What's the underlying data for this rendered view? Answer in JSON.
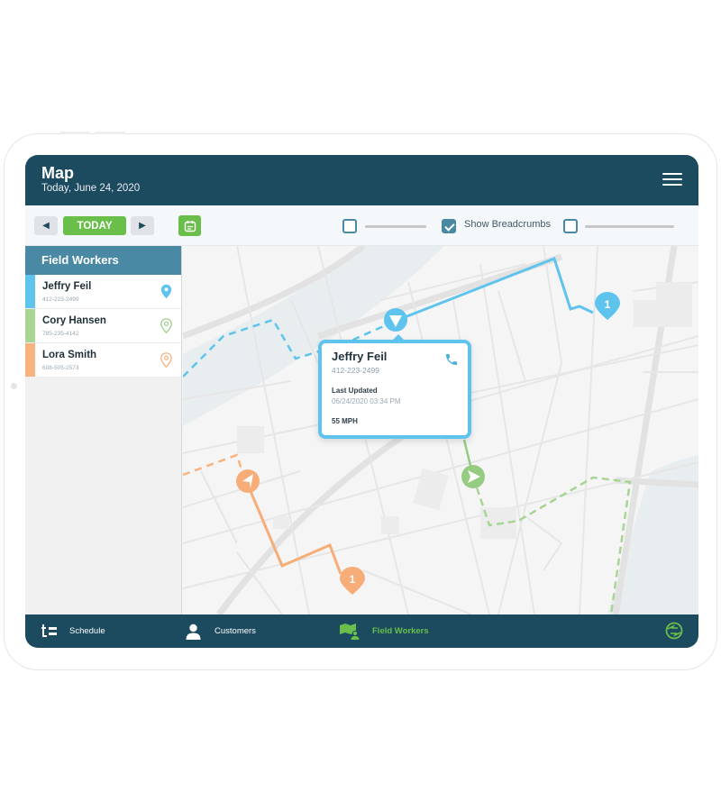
{
  "header": {
    "title": "Map",
    "subtitle": "Today, June 24, 2020",
    "menu_icon": "hamburger-menu-icon"
  },
  "toolbar": {
    "prev_icon": "arrow-left-icon",
    "today_label": "TODAY",
    "next_icon": "arrow-right-icon",
    "calendar_icon": "calendar-icon",
    "prev_glyph": "◀",
    "next_glyph": "▶",
    "checkboxes": [
      {
        "label": "",
        "checked": false
      },
      {
        "label": "Show Breadcrumbs",
        "checked": true
      },
      {
        "label": "",
        "checked": false
      }
    ]
  },
  "sidebar": {
    "title": "Field Workers",
    "workers": [
      {
        "name": "Jeffry Feil",
        "phone": "412-223-2499",
        "color": "#5ec4ee",
        "pin": "filled"
      },
      {
        "name": "Cory Hansen",
        "phone": "785-235-4142",
        "color": "#a9d494",
        "pin": "outline"
      },
      {
        "name": "Lora Smith",
        "phone": "608-505-2573",
        "color": "#f9b37f",
        "pin": "outline"
      }
    ]
  },
  "popup": {
    "name": "Jeffry Feil",
    "phone": "412-223-2499",
    "last_updated_label": "Last Updated",
    "last_updated": "06/24/2020  03:34 PM",
    "speed": "55 MPH",
    "call_icon": "phone-icon"
  },
  "map": {
    "markers": [
      {
        "worker": "Jeffry Feil",
        "type": "vehicle",
        "color": "#5ec4ee"
      },
      {
        "worker": "Jeffry Feil",
        "type": "stop",
        "label": "1",
        "color": "#5ec4ee"
      },
      {
        "worker": "Cory Hansen",
        "type": "vehicle",
        "color": "#96cc82"
      },
      {
        "worker": "Lora Smith",
        "type": "vehicle",
        "color": "#f7ad78"
      },
      {
        "worker": "Lora Smith",
        "type": "stop",
        "label": "1",
        "color": "#f7ad78"
      }
    ]
  },
  "bottom_nav": {
    "tabs": [
      {
        "label": "Schedule",
        "icon": "schedule-icon",
        "active": false
      },
      {
        "label": "Customers",
        "icon": "user-icon",
        "active": false
      },
      {
        "label": "Field Workers",
        "icon": "map-user-icon",
        "active": true
      }
    ],
    "sync_icon": "sync-icon"
  },
  "colors": {
    "primary": "#1c4a5f",
    "secondary": "#4a89a4",
    "accent_green": "#6abf4b",
    "blue": "#5ec4ee",
    "green": "#a9d494",
    "orange": "#f9b37f"
  }
}
